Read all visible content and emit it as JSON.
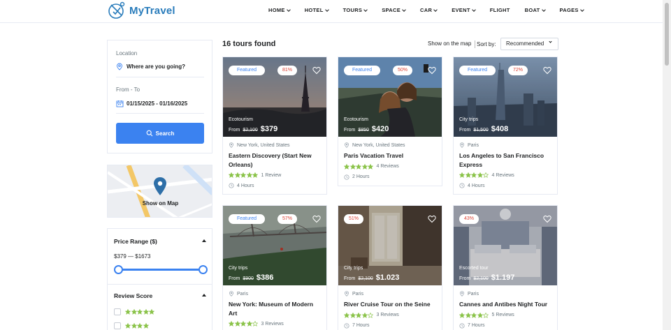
{
  "brand": {
    "name": "MyTravel",
    "color": "#297cbb"
  },
  "nav": [
    "HOME",
    "HOTEL",
    "TOURS",
    "SPACE",
    "CAR",
    "EVENT",
    "FLIGHT",
    "BOAT",
    "PAGES"
  ],
  "search": {
    "location_label": "Location",
    "location_placeholder": "Where are you going?",
    "dates_label": "From - To",
    "dates_value": "01/15/2025 - 01/16/2025",
    "button_label": "Search"
  },
  "map": {
    "label": "Show on Map"
  },
  "filters": {
    "price_title": "Price Range ($)",
    "price_value": "$379 — $1673",
    "price_slider": {
      "min_fraction": 0,
      "max_fraction": 1
    },
    "review_title": "Review Score",
    "review_rows": [
      5,
      4
    ]
  },
  "results": {
    "count": "16 tours found",
    "show_map": "Show on the map",
    "sort_label": "Sort by:",
    "sort_value": "Recommended"
  },
  "colors": {
    "accent": "#3b82f0",
    "star": "#8bc34a",
    "sale": "#de4437"
  },
  "tours": [
    {
      "featured": "Featured",
      "discount": "81%",
      "category": "Ecotourism",
      "from": "From",
      "old_price": "$2,100",
      "price": "$379",
      "location": "New York, United States",
      "title": "Eastern Discovery (Start New Orleans)",
      "stars": 5,
      "reviews": "1 Review",
      "duration": "4 Hours",
      "scene": "eiffel"
    },
    {
      "featured": "Featured",
      "discount": "50%",
      "category": "Ecotourism",
      "from": "From",
      "old_price": "$850",
      "price": "$420",
      "location": "New York, United States",
      "title": "Paris Vacation Travel",
      "stars": 5,
      "reviews": "4 Reviews",
      "duration": "2 Hours",
      "scene": "selfie"
    },
    {
      "featured": "Featured",
      "discount": "72%",
      "category": "City trips",
      "from": "From",
      "old_price": "$1,500",
      "price": "$408",
      "location": "Paris",
      "title": "Los Angeles to San Francisco Express",
      "stars": 4,
      "reviews": "4 Reviews",
      "duration": "4 Hours",
      "scene": "tower"
    },
    {
      "featured": "Featured",
      "discount": "57%",
      "category": "City trips",
      "from": "From",
      "old_price": "$900",
      "price": "$386",
      "location": "Paris",
      "title": "New York: Museum of Modern Art",
      "stars": 4,
      "reviews": "3 Reviews",
      "duration": "",
      "scene": "bridge"
    },
    {
      "featured": "",
      "discount": "51%",
      "category": "City trips",
      "from": "From",
      "old_price": "$2,100",
      "price": "$1.023",
      "location": "Paris",
      "title": "River Cruise Tour on the Seine",
      "stars": 4,
      "reviews": "3 Reviews",
      "duration": "7 Hours",
      "scene": "lobby"
    },
    {
      "featured": "",
      "discount": "43%",
      "category": "Escorted tour",
      "from": "From",
      "old_price": "$2,100",
      "price": "$1.197",
      "location": "Paris",
      "title": "Cannes and Antibes Night Tour",
      "stars": 4,
      "reviews": "5 Reviews",
      "duration": "7 Hours",
      "scene": "bedroom"
    }
  ]
}
